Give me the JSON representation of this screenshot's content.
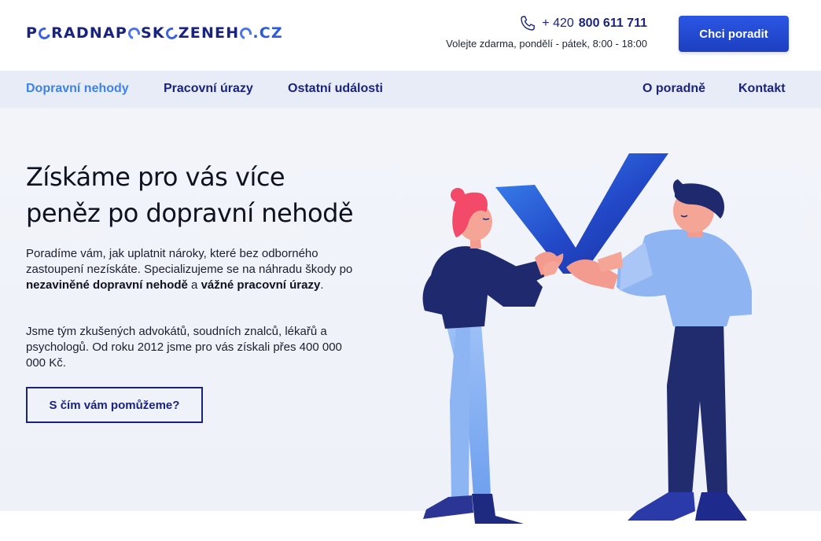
{
  "header": {
    "logo_text_before": "P",
    "logo_text_mid1": "RADNAP",
    "logo_text_mid2": "SK",
    "logo_text_mid3": "ZENEH",
    "logo_text_end": ".CZ",
    "phone_prefix": "+ 420",
    "phone_number": "800 611 711",
    "phone_note": "Volejte zdarma, pondělí - pátek, 8:00 - 18:00",
    "cta_label": "Chci poradit",
    "phone_icon": "phone-icon"
  },
  "nav": {
    "left": [
      {
        "label": "Dopravní nehody",
        "active": true
      },
      {
        "label": "Pracovní úrazy",
        "active": false
      },
      {
        "label": "Ostatní události",
        "active": false
      }
    ],
    "right": [
      {
        "label": "O poradně"
      },
      {
        "label": "Kontakt"
      }
    ]
  },
  "hero": {
    "title_line1": "Získáme pro vás více",
    "title_line2": "peněz po dopravní nehodě",
    "p1_part1": "Poradíme vám, jak uplatnit nároky, které bez odborného zastoupení nezískáte. Specializujeme se na náhradu škody po ",
    "p1_bold1": "nezaviněné dopravní nehodě",
    "p1_part2": " a ",
    "p1_bold2": "vážné pracovní úrazy",
    "p1_part3": ".",
    "p2": "Jsme tým zkušených advokátů, soudních znalců, lékařů a psychologů. Od roku 2012 jsme pro vás získali přes 400 000 000 Kč.",
    "cta_label": "S čím vám pomůžeme?"
  },
  "colors": {
    "brand_dark": "#1a237e",
    "brand_blue": "#2b56e4",
    "nav_active": "#3d82e6",
    "nav_bg": "#e8ecf7"
  }
}
